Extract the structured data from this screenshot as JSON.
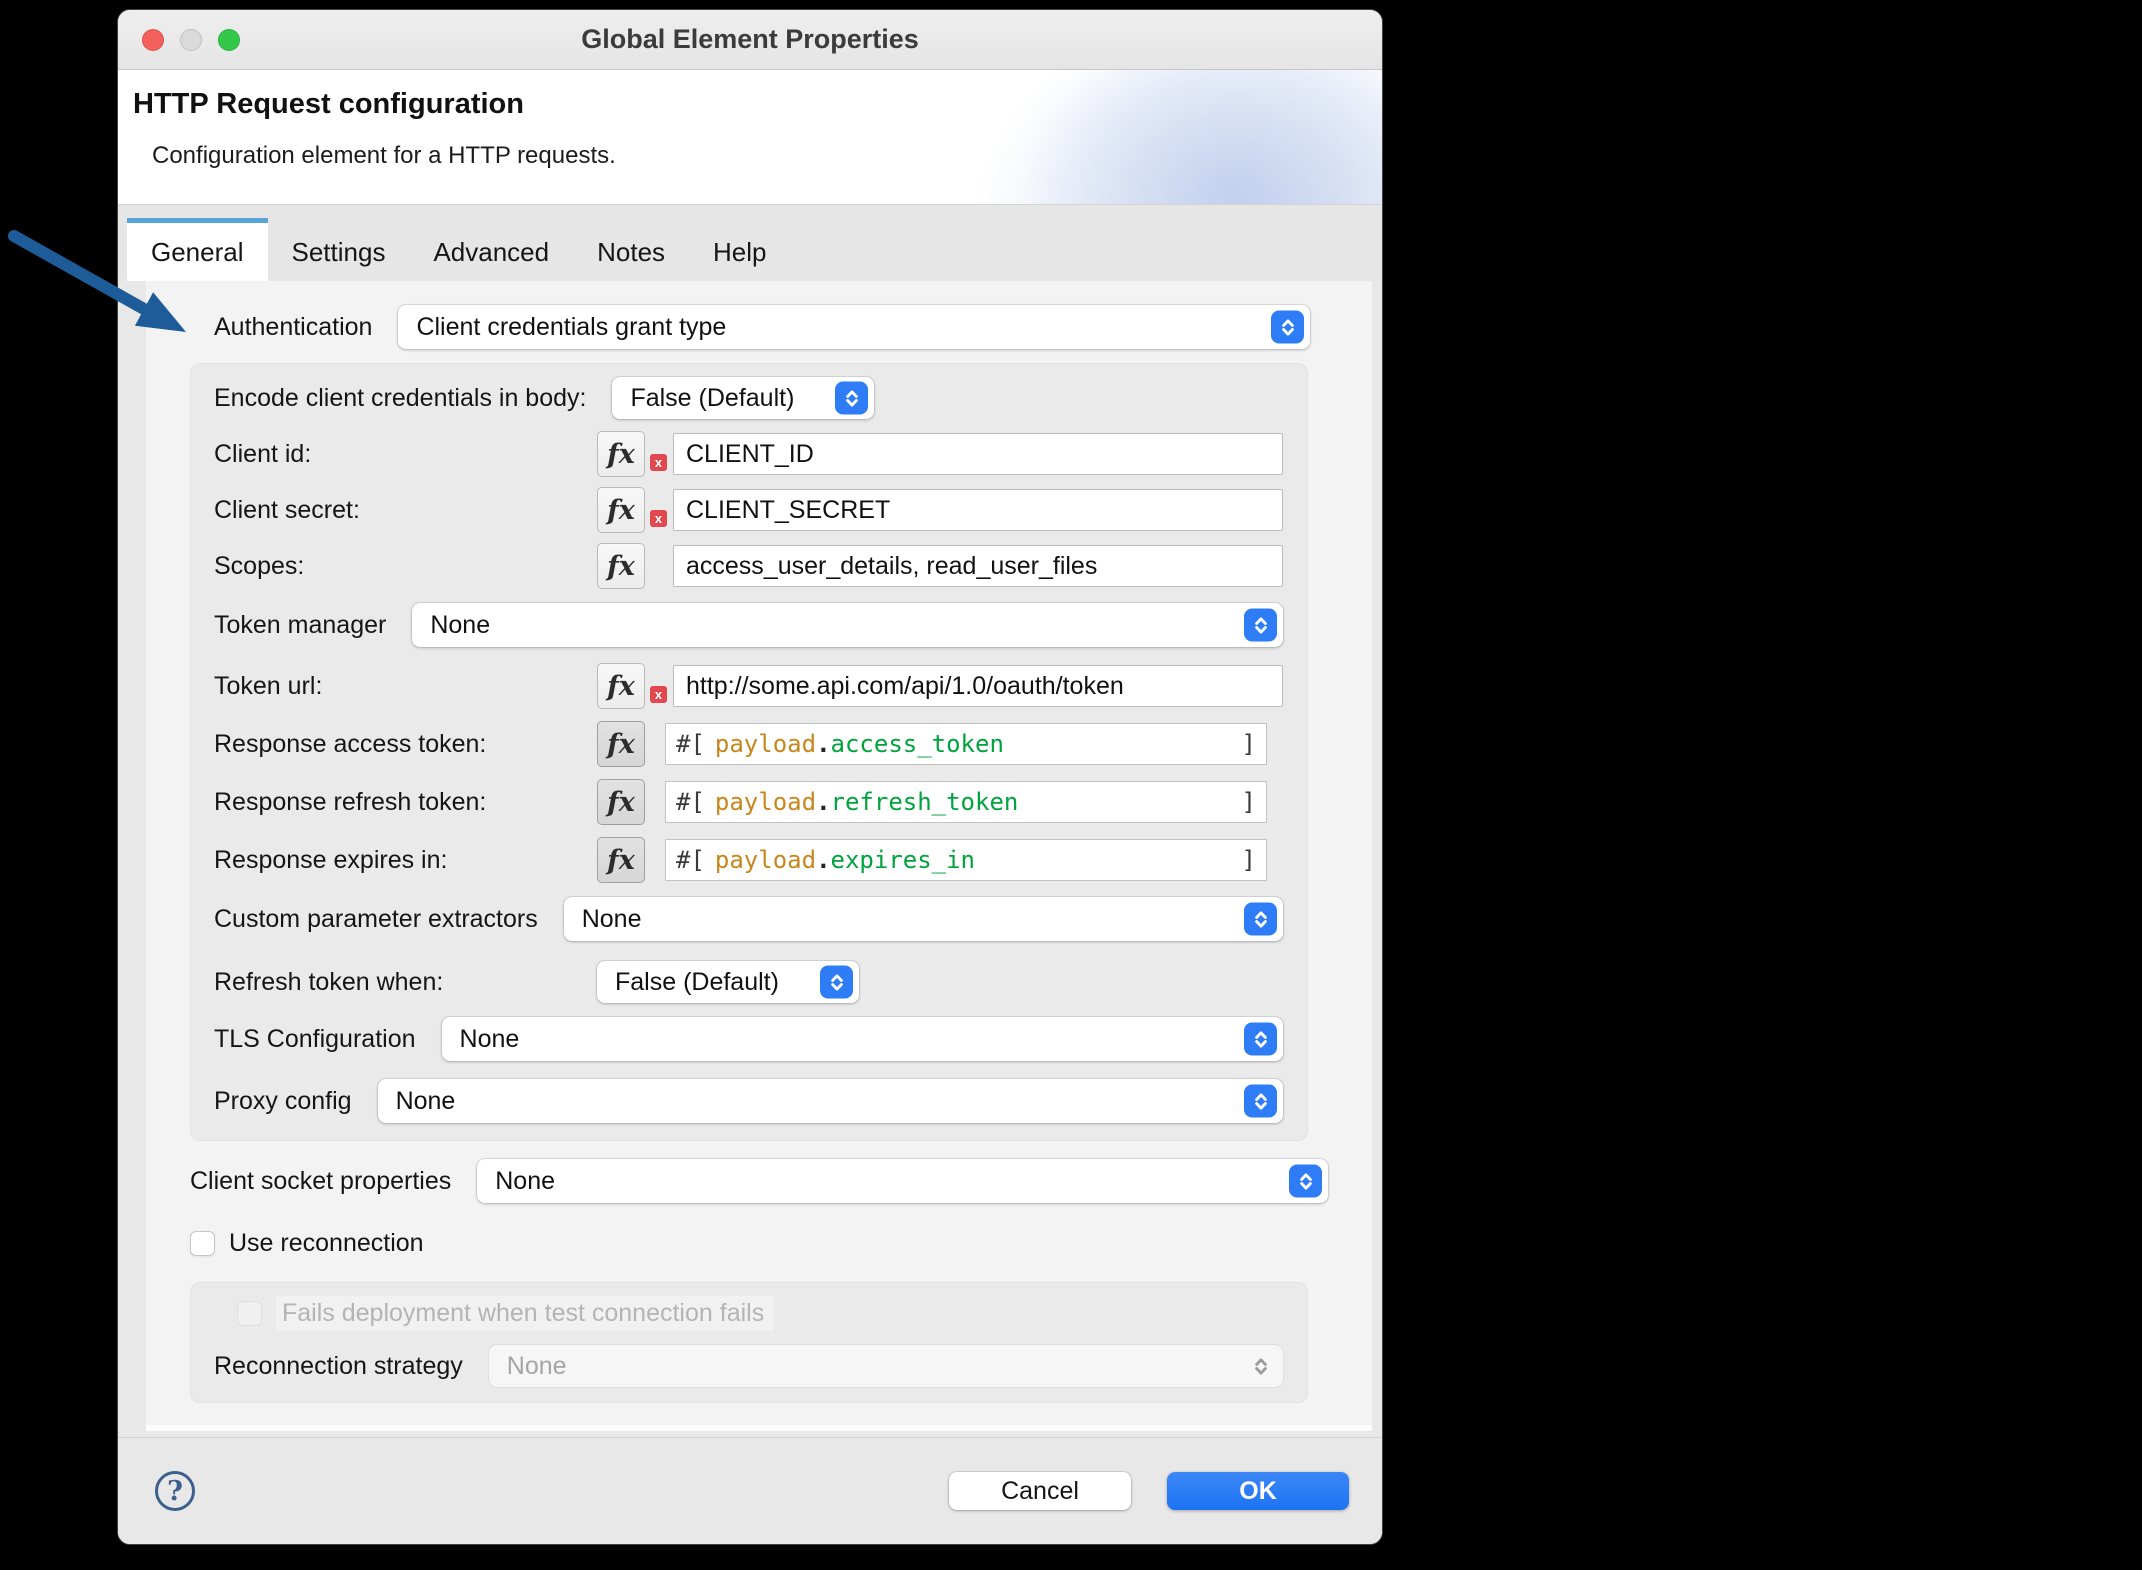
{
  "window": {
    "title": "Global Element Properties",
    "traffic_lights": {
      "close": "#f4615c",
      "minimize": "#dadada",
      "zoom": "#34c84a"
    }
  },
  "header": {
    "title": "HTTP Request configuration",
    "subtitle": "Configuration element for a HTTP requests."
  },
  "tabs": {
    "general": "General",
    "settings": "Settings",
    "advanced": "Advanced",
    "notes": "Notes",
    "help": "Help"
  },
  "form": {
    "authentication": {
      "label": "Authentication",
      "value": "Client credentials grant type"
    },
    "panel": {
      "encode": {
        "label": "Encode client credentials in body:",
        "value": "False (Default)"
      },
      "client_id": {
        "label": "Client id:",
        "value": "CLIENT_ID",
        "error": true
      },
      "client_secret": {
        "label": "Client secret:",
        "value": "CLIENT_SECRET",
        "error": true
      },
      "scopes": {
        "label": "Scopes:",
        "value": "access_user_details, read_user_files"
      },
      "token_manager": {
        "label": "Token manager",
        "value": "None"
      },
      "token_url": {
        "label": "Token url:",
        "value": "http://some.api.com/api/1.0/oauth/token",
        "error": true
      },
      "response_access_token": {
        "label": "Response access token:",
        "open": "#[",
        "object": "payload",
        "dot": ".",
        "field": "access_token",
        "close": "]"
      },
      "response_refresh_token": {
        "label": "Response refresh token:",
        "open": "#[",
        "object": "payload",
        "dot": ".",
        "field": "refresh_token",
        "close": "]"
      },
      "response_expires_in": {
        "label": "Response expires in:",
        "open": "#[",
        "object": "payload",
        "dot": ".",
        "field": "expires_in",
        "close": "]"
      },
      "custom_extractors": {
        "label": "Custom parameter extractors",
        "value": "None"
      },
      "refresh_token_when": {
        "label": "Refresh token when:",
        "value": "False (Default)"
      },
      "tls": {
        "label": "TLS Configuration",
        "value": "None"
      },
      "proxy": {
        "label": "Proxy config",
        "value": "None"
      }
    },
    "client_socket": {
      "label": "Client socket properties",
      "value": "None"
    },
    "use_reconnection": {
      "label": "Use reconnection",
      "checked": false
    },
    "reconnection_panel": {
      "fails_deployment": {
        "label": "Fails deployment when test connection fails",
        "checked": false
      },
      "strategy": {
        "label": "Reconnection strategy",
        "value": "None"
      }
    }
  },
  "footer": {
    "help": "?",
    "cancel": "Cancel",
    "ok": "OK"
  },
  "icons": {
    "fx": "fx",
    "error_badge": "x"
  },
  "colors": {
    "accent_blue_stepper": "#2e7df6",
    "ok_button": "#1d73f3",
    "active_tab_accent": "#58a6d8",
    "annotation_arrow": "#1d5c99",
    "error_badge": "#e0474f",
    "expression_object": "#c8861c",
    "expression_field": "#00a33e"
  }
}
